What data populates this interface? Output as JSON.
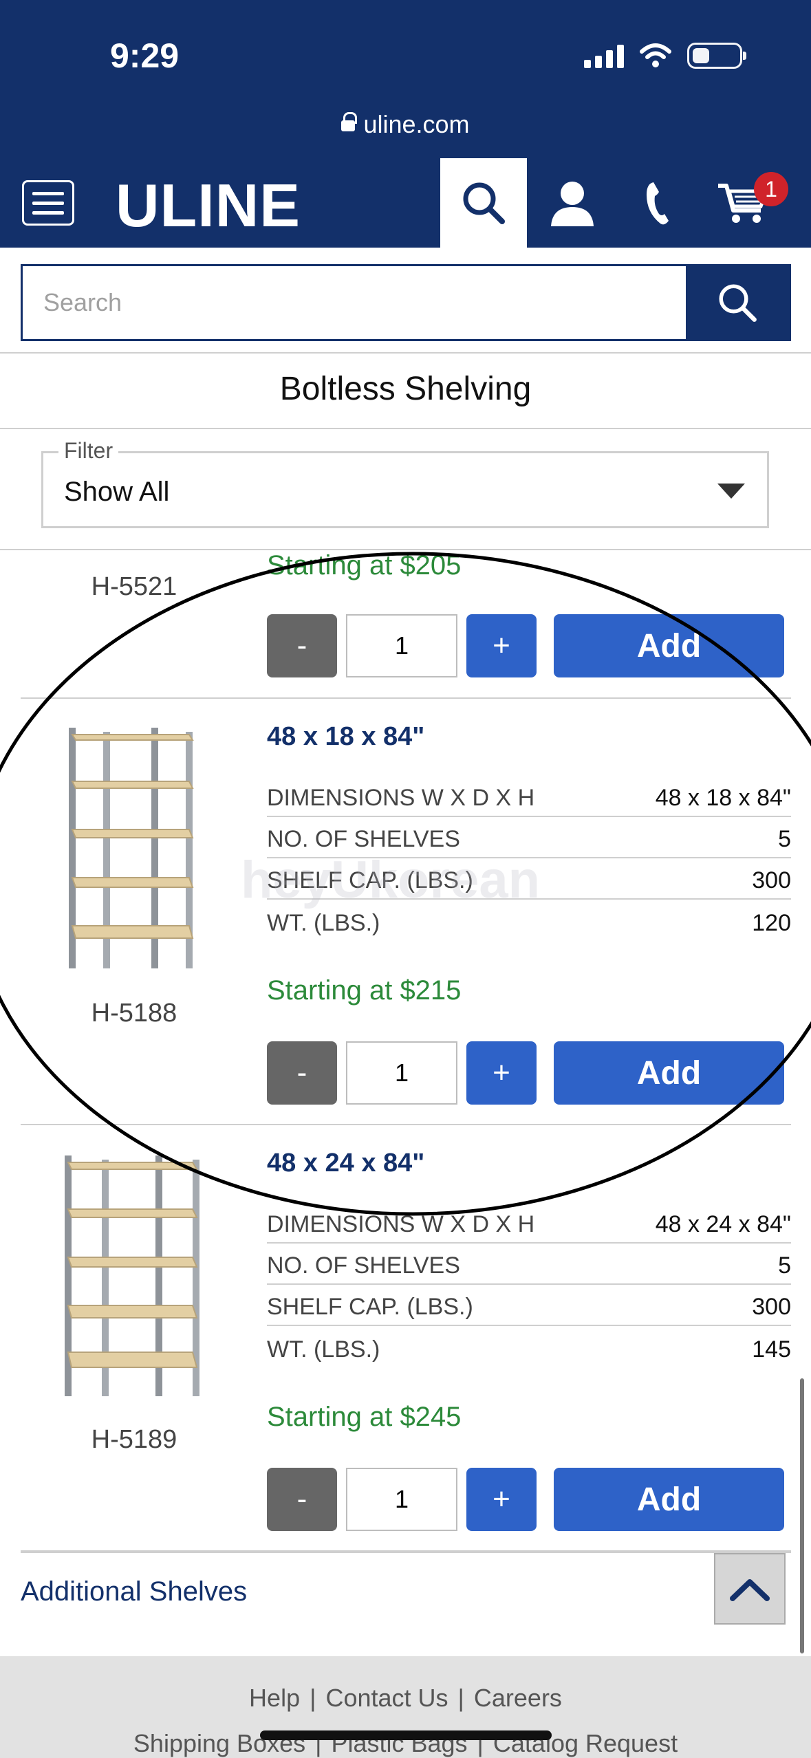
{
  "status_bar": {
    "time": "9:29"
  },
  "browser": {
    "url": "uline.com"
  },
  "header": {
    "logo": "ULINE",
    "cart_count": "1"
  },
  "search": {
    "placeholder": "Search"
  },
  "page": {
    "title": "Boltless Shelving"
  },
  "filter": {
    "legend": "Filter",
    "value": "Show All"
  },
  "products": [
    {
      "sku": "H-5521",
      "price": "Starting at $205",
      "qty": "1",
      "minus_label": "-",
      "plus_label": "+",
      "add_label": "Add"
    },
    {
      "title": "48 x 18 x 84\"",
      "sku": "H-5188",
      "specs": [
        {
          "label": "DIMENSIONS W X D X H",
          "value": "48 x 18 x 84\""
        },
        {
          "label": "NO. OF SHELVES",
          "value": "5"
        },
        {
          "label": "SHELF CAP. (LBS.)",
          "value": "300"
        },
        {
          "label": "WT. (LBS.)",
          "value": "120"
        }
      ],
      "price": "Starting at $215",
      "qty": "1",
      "minus_label": "-",
      "plus_label": "+",
      "add_label": "Add"
    },
    {
      "title": "48 x 24 x 84\"",
      "sku": "H-5189",
      "specs": [
        {
          "label": "DIMENSIONS W X D X H",
          "value": "48 x 24 x 84\""
        },
        {
          "label": "NO. OF SHELVES",
          "value": "5"
        },
        {
          "label": "SHELF CAP. (LBS.)",
          "value": "300"
        },
        {
          "label": "WT. (LBS.)",
          "value": "145"
        }
      ],
      "price": "Starting at $245",
      "qty": "1",
      "minus_label": "-",
      "plus_label": "+",
      "add_label": "Add"
    }
  ],
  "watermark": "heyUkorean",
  "additional": {
    "label": "Additional Shelves"
  },
  "footer": {
    "row1": [
      "Help",
      "Contact Us",
      "Careers"
    ],
    "row2": [
      "Shipping Boxes",
      "Plastic Bags",
      "Catalog Request"
    ],
    "separator": "|"
  },
  "colors": {
    "brand_navy": "#13306a",
    "add_blue": "#2e62c8",
    "price_green": "#2c8a3a",
    "badge_red": "#d0232a"
  },
  "icons": [
    "lock-icon",
    "hamburger-menu-icon",
    "search-icon",
    "user-icon",
    "phone-icon",
    "cart-icon",
    "chevron-down-icon",
    "chevron-up-icon",
    "shelf-product-image"
  ]
}
